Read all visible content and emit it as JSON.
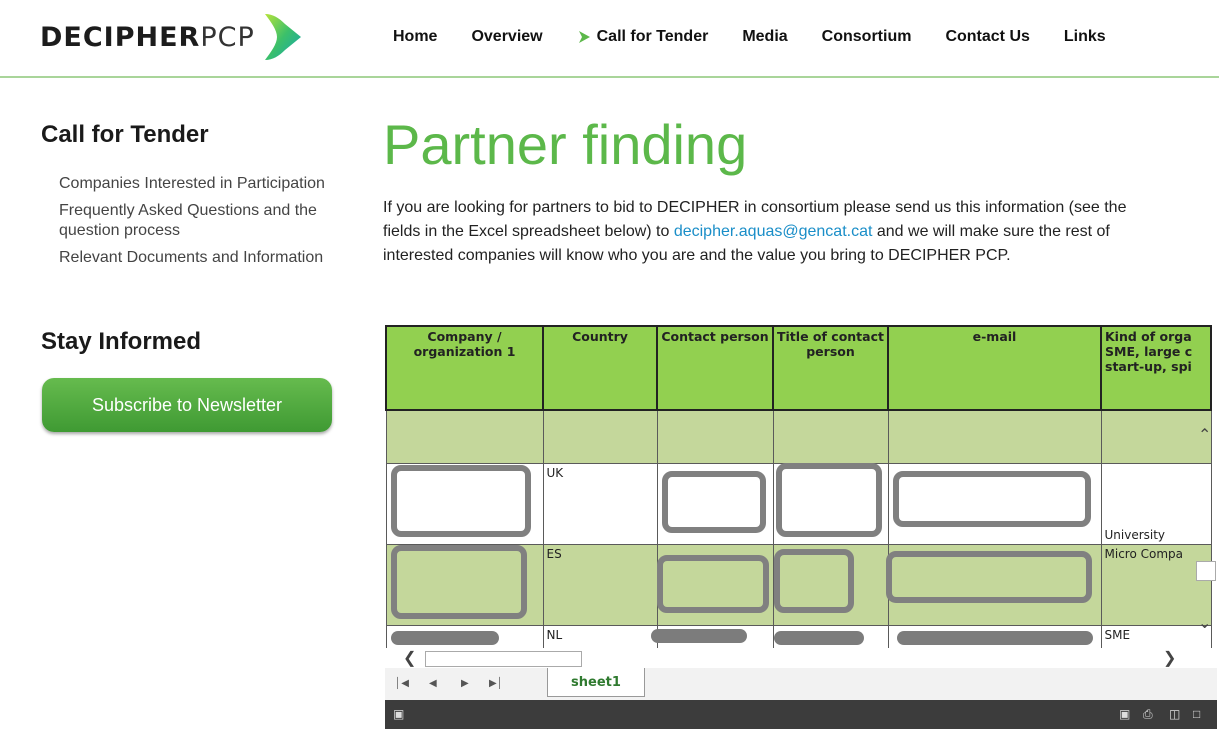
{
  "header": {
    "logo_bold": "DECIPHER",
    "logo_light": "PCP",
    "nav": [
      "Home",
      "Overview",
      "Call for Tender",
      "Media",
      "Consortium",
      "Contact Us",
      "Links"
    ]
  },
  "sidebar": {
    "heading": "Call for Tender",
    "links": [
      "Companies Interested in Participation",
      "Frequently Asked Questions and the question process",
      "Relevant Documents and Information"
    ],
    "stay_heading": "Stay Informed",
    "subscribe_label": "Subscribe to Newsletter"
  },
  "main": {
    "title": "Partner finding",
    "intro_before": "If you are looking for partners to bid to DECIPHER in consortium please send us this information (see the fields in the Excel spreadsheet below) to ",
    "intro_email": "decipher.aquas@gencat.cat",
    "intro_after": " and we will make sure the rest of interested companies will know who you are and the value you bring to DECIPHER PCP."
  },
  "sheet": {
    "headers": [
      "Company / organization 1",
      "Country",
      "Contact person",
      "Title of contact person",
      "e-mail",
      "Kind of orga SME, large c start-up, spi"
    ],
    "rows": [
      {
        "country": "UK",
        "kind": "University"
      },
      {
        "country": "ES",
        "kind": "Micro Compa"
      },
      {
        "country": "NL",
        "kind": "SME"
      }
    ],
    "tab_label": "sheet1"
  },
  "colors": {
    "brand_green": "#5cb84a",
    "header_green": "#92d050",
    "row_green": "#c4d79b",
    "link_blue": "#1a8ec8"
  }
}
